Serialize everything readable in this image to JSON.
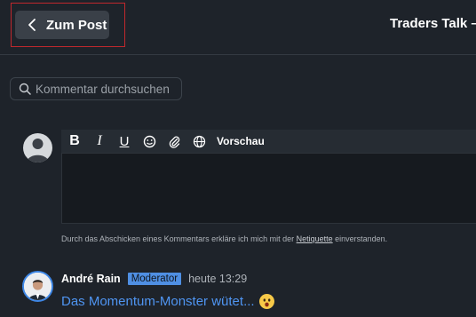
{
  "header": {
    "back_label": "Zum Post",
    "channel_title": "Traders Talk –"
  },
  "search": {
    "placeholder": "Kommentar durchsuchen",
    "value": ""
  },
  "editor": {
    "toolbar": {
      "bold": "B",
      "italic": "I",
      "underline": "U",
      "preview_label": "Vorschau"
    },
    "text": ""
  },
  "disclaimer": {
    "before": "Durch das Abschicken eines Kommentars erkläre ich mich mit der ",
    "link": "Netiquette",
    "after": " einverstanden."
  },
  "comments": [
    {
      "author": "André Rain",
      "badge": "Moderator",
      "time": "heute 13:29",
      "text": "Das Momentum-Monster wütet...",
      "emoji": "surprised-face-emoji"
    }
  ],
  "colors": {
    "background": "#1e232a",
    "accent": "#4f8fe3",
    "link_text": "#4f95f2",
    "highlight_border": "#c0282d"
  }
}
